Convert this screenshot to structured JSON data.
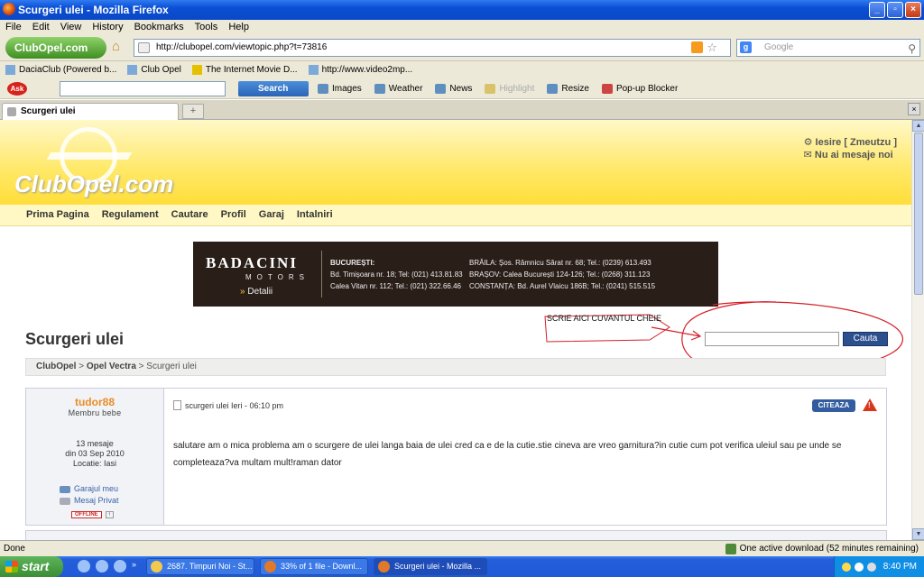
{
  "window": {
    "title": "Scurgeri ulei - Mozilla Firefox"
  },
  "menu": [
    "File",
    "Edit",
    "View",
    "History",
    "Bookmarks",
    "Tools",
    "Help"
  ],
  "nav": {
    "logo_text": "ClubOpel.com",
    "url": "http://clubopel.com/viewtopic.php?t=73816",
    "search_placeholder": "Google"
  },
  "bookmarks": [
    "DaciaClub (Powered b...",
    "Club Opel",
    "The Internet Movie D...",
    "http://www.video2mp..."
  ],
  "ask_toolbar": {
    "logo": "Ask",
    "search_label": "Search",
    "items": [
      "Images",
      "Weather",
      "News",
      "Highlight",
      "Resize",
      "Pop-up Blocker"
    ]
  },
  "tab": {
    "label": "Scurgeri ulei",
    "new_tab": "+",
    "close": "×"
  },
  "site": {
    "logo": "ClubOpel.com",
    "user_logout": "Iesire [ Zmeutzu ]",
    "user_messages": "Nu ai mesaje noi",
    "nav": [
      "Prima Pagina",
      "Regulament",
      "Cautare",
      "Profil",
      "Garaj",
      "Intalniri"
    ]
  },
  "banner": {
    "brand": "BADACINI",
    "subtitle": "MOTORS",
    "details": "Detalii",
    "col1": [
      "BUCUREȘTI:",
      "Bd. Timișoara nr. 18; Tel: (021) 413.81.83",
      "Calea Vitan nr. 112; Tel.: (021) 322.66.46"
    ],
    "col2": [
      "BRĂILA: Șos. Râmnicu Sărat nr. 68; Tel.: (0239) 613.493",
      "BRAȘOV: Calea București 124-126; Tel.: (0268) 311.123",
      "CONSTANȚA: Bd. Aurel Vlaicu 186B; Tel.: (0241) 515.515"
    ]
  },
  "page": {
    "title": "Scurgeri ulei",
    "search_button": "Cauta",
    "annotation": "SCRIE AICI CUVANTUL CHEIE",
    "breadcrumb": [
      "ClubOpel",
      "Opel Vectra",
      "Scurgeri ulei"
    ]
  },
  "post": {
    "author": "tudor88",
    "rank": "Membru bebe",
    "messages": "13 mesaje",
    "joined": "din 03 Sep 2010",
    "location": "Locatie: Iasi",
    "links": [
      "Garajul meu",
      "Mesaj Privat"
    ],
    "offline": "OFFLINE",
    "up": "↑",
    "header": "scurgeri ulei Ieri - 06:10 pm",
    "quote_button": "CITEAZA",
    "body": "salutare am o mica problema am o scurgere de ulei langa baia de ulei cred ca e de la cutie.stie cineva are vreo garnitura?in cutie cum pot verifica uleiul sau pe unde se completeaza?va multam mult!raman dator"
  },
  "status": {
    "left": "Done",
    "download": "One active download (52 minutes remaining)"
  },
  "taskbar": {
    "start": "start",
    "tasks": [
      "2687. Timpuri Noi - St...",
      "33% of 1 file - Downl...",
      "Scurgeri ulei - Mozilla ..."
    ],
    "clock": "8:40 PM"
  },
  "colors": {
    "accent_yellow": "#ffe866",
    "post_author": "#e98c25",
    "button_blue": "#2c4f8d",
    "annotation_red": "#d4202a"
  }
}
